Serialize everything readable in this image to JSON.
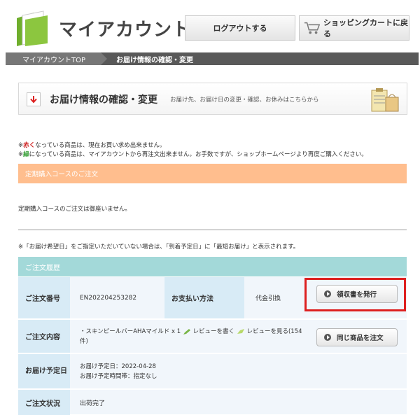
{
  "header": {
    "site_title": "マイアカウント",
    "logout_label": "ログアウトする",
    "cart_label": "ショッピングカートに戻る"
  },
  "breadcrumb": {
    "top_label": "マイアカウントTOP",
    "current_label": "お届け情報の確認・変更"
  },
  "section": {
    "title": "お届け情報の確認・変更",
    "description": "お届け先、お届け日の変更・確認、お休みはこちらから"
  },
  "notes": {
    "line1_prefix": "※",
    "line1_red": "赤く",
    "line1_rest": "なっている商品は、現在お買い求め出来ません。",
    "line2_prefix": "※",
    "line2_green": "緑",
    "line2_rest": "になっている商品は、マイアカウントから再注文出来ません。お手数ですが、ショップホームページより再度ご購入ください。"
  },
  "subscription": {
    "heading": "定期購入コースのご注文",
    "message": "定期購入コースのご注文は御座いません。"
  },
  "delivery_note": "※「お届け希望日」をご指定いただいていない場合は、「到着予定日」に「最短お届け」と表示されます。",
  "order_history": {
    "heading": "ご注文履歴",
    "order_number_label": "ご注文番号",
    "order_number": "EN202204253282",
    "payment_label": "お支払い方法",
    "payment_value": "代金引換",
    "receipt_button": "領収書を発行",
    "content_label": "ご注文内容",
    "product_text": "・スキンピールバーAHAマイルド x 1",
    "write_review": "レビューを書く",
    "view_review": "レビューを見る(154件)",
    "reorder_button": "同じ商品を注文",
    "delivery_label": "お届け予定日",
    "delivery_date": "お届け予定日：2022-04-28",
    "delivery_time": "お届け予定時間帯：指定なし",
    "status_label": "ご注文状況",
    "status_value": "出荷完了"
  },
  "colors": {
    "orange_bar": "#ffbe8e",
    "teal_bar": "#a3d9d9",
    "label_blue": "#d8ebf6",
    "highlight_red": "#dd2020",
    "logo_green": "#8cc63f"
  }
}
